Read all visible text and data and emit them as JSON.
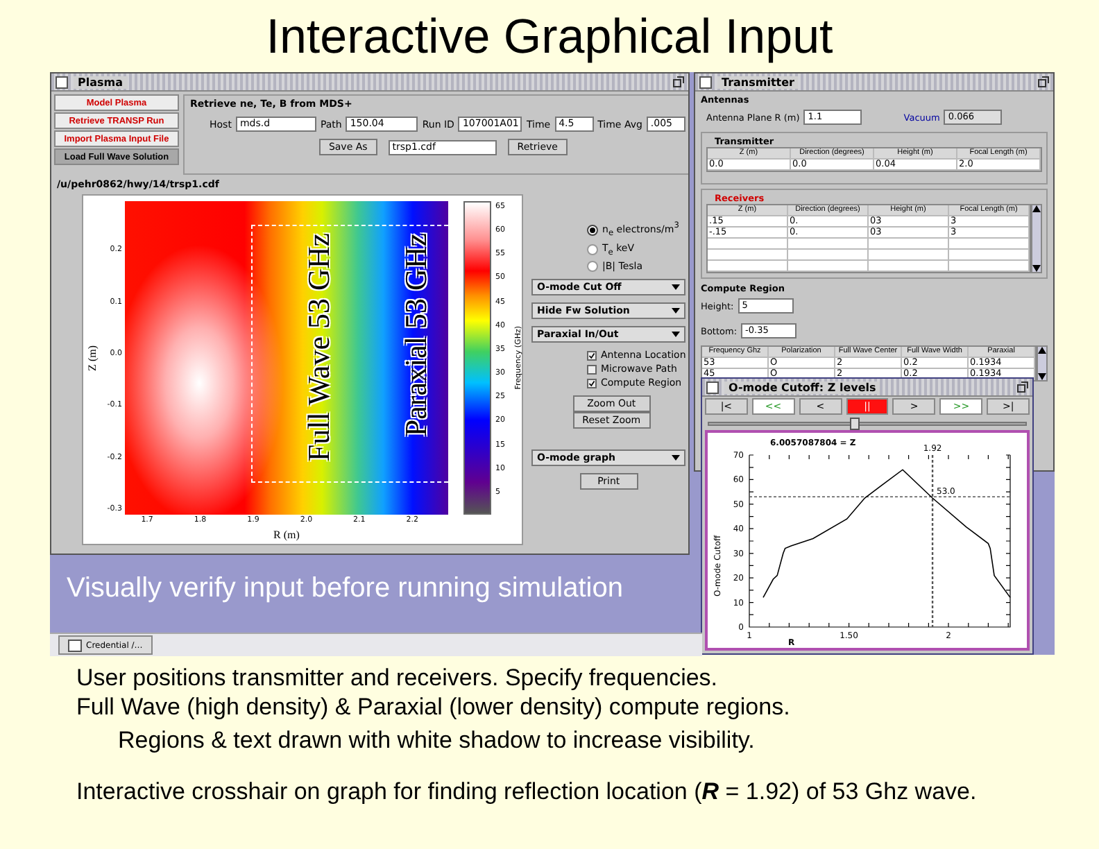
{
  "title": "Interactive Graphical Input",
  "plasma_window": {
    "title": "Plasma",
    "modes": [
      {
        "label": "Model Plasma",
        "selected": false
      },
      {
        "label": "Retrieve TRANSP Run",
        "selected": false
      },
      {
        "label": "Import Plasma Input File",
        "selected": false
      },
      {
        "label": "Load Full Wave Solution",
        "selected": true
      }
    ],
    "mds_label": "Retrieve ne, Te, B from MDS+",
    "fields": [
      {
        "label": "Host",
        "value": "mds.d"
      },
      {
        "label": "Path",
        "value": "150.04"
      },
      {
        "label": "Run ID",
        "value": "107001A01"
      },
      {
        "label": "Time",
        "value": "4.5"
      },
      {
        "label": "Time Avg",
        "value": ".005"
      }
    ],
    "save_button": "Save As",
    "save_field": "trsp1.cdf",
    "retrieve_button": "Retrieve",
    "file_path": "/u/pehr0862/hwy/14/trsp1.cdf",
    "contour_plot": {
      "xlabel": "R (m)",
      "ylabel": "Z (m)",
      "xticks": [
        "1.7",
        "1.8",
        "1.9",
        "2.0",
        "2.1",
        "2.2"
      ],
      "yticks": [
        "0.2",
        "0.1",
        "0.0",
        "-0.1",
        "-0.2",
        "-0.3"
      ],
      "colorbar_label": "Frequency (GHz)",
      "colorbar_ticks": [
        "65",
        "60",
        "55",
        "50",
        "45",
        "40",
        "35",
        "30",
        "25",
        "20",
        "15",
        "10",
        "5"
      ],
      "overlays": [
        "Full Wave 53 GHz",
        "Paraxial 53 GHz"
      ]
    },
    "quantities": [
      {
        "label": "n$_{e}$ electrons/m$^{3}$",
        "selected": true
      },
      {
        "label": "T$_{e}$ keV",
        "selected": false
      },
      {
        "label": "|B| Tesla",
        "selected": false
      }
    ],
    "dropdowns": [
      "O-mode Cut Off",
      "Hide Fw Solution",
      "Paraxial In/Out"
    ],
    "checkboxes": [
      {
        "label": "Antenna Location",
        "checked": true
      },
      {
        "label": "Microwave Path",
        "checked": false
      },
      {
        "label": "Compute Region",
        "checked": true
      }
    ],
    "zoom_buttons": [
      "Zoom Out",
      "Reset Zoom"
    ],
    "graph_dropdown": "O-mode graph",
    "print_button": "Print"
  },
  "transmitter_window": {
    "title": "Transmitter",
    "antennas_header": "Antennas",
    "antenna_plane": {
      "label": "Antenna Plane R (m)",
      "value": "1.1"
    },
    "vacuum": {
      "label": "Vacuum",
      "value": "0.066"
    },
    "transmitter": {
      "header": "Transmitter",
      "columns": [
        "Z (m)",
        "Direction (degrees)",
        "Height (m)",
        "Focal Length (m)"
      ],
      "rows": [
        [
          "0.0",
          "0.0",
          "0.04",
          "2.0"
        ]
      ]
    },
    "receivers": {
      "header": "Receivers",
      "columns": [
        "Z (m)",
        "Direction (degrees)",
        "Height (m)",
        "Focal Length (m)"
      ],
      "rows": [
        [
          ".15",
          "0.",
          "03",
          "3"
        ],
        [
          "-.15",
          "0.",
          "03",
          "3"
        ]
      ]
    },
    "compute_header": "Compute Region",
    "height": {
      "label": "Height:",
      "value": "5"
    },
    "bottom": {
      "label": "Bottom:",
      "value": "-0.35"
    },
    "frequencies": {
      "columns": [
        "Frequency Ghz",
        "Polarization",
        "Full Wave Center",
        "Full Wave Width",
        "Paraxial"
      ],
      "rows": [
        [
          "53",
          "O",
          "2",
          "0.2",
          "0.1934"
        ],
        [
          "45",
          "O",
          "2",
          "0.2",
          "0.1934"
        ]
      ]
    }
  },
  "cutoff_window": {
    "title": "O-mode Cutoff: Z levels",
    "controls": [
      {
        "label": "|<",
        "kind": "step",
        "selected": false
      },
      {
        "label": "<<",
        "kind": "fast",
        "selected": false
      },
      {
        "label": "<",
        "kind": "step",
        "selected": false
      },
      {
        "label": "||",
        "kind": "step",
        "selected": true
      },
      {
        "label": ">",
        "kind": "step",
        "selected": false
      },
      {
        "label": ">>",
        "kind": "fast",
        "selected": false
      },
      {
        "label": ">|",
        "kind": "step",
        "selected": false
      }
    ],
    "slider": {
      "level": 0.46
    },
    "chart_data": {
      "type": "line",
      "title": "6.0057087804 = Z",
      "xlabel": "R",
      "ylabel": "O-mode Cutoff",
      "xlim": [
        1,
        2.31
      ],
      "ylim": [
        0,
        70
      ],
      "x": [
        1.07,
        1.12,
        1.14,
        1.17,
        1.18,
        1.21,
        1.32,
        1.49,
        1.58,
        1.77,
        1.92,
        2.09,
        2.2,
        2.21,
        2.23,
        2.31
      ],
      "series": [
        {
          "color": "#000000",
          "values": [
            12,
            19.5,
            21,
            30,
            32,
            33,
            36,
            44,
            52.5,
            64,
            52.5,
            40.7,
            34,
            32,
            21,
            12
          ]
        }
      ],
      "xticks": [
        {
          "value": 1,
          "label": "1"
        },
        {
          "value": 1.5,
          "label": "1.50"
        },
        {
          "value": 2,
          "label": "2"
        }
      ],
      "yticks": [
        0,
        10,
        20,
        30,
        40,
        50,
        60,
        70
      ],
      "ref_lines": [
        {
          "axis": "x",
          "value": 1.92,
          "label": "1.92"
        },
        {
          "axis": "y",
          "value": 53,
          "label": "53.0"
        }
      ]
    }
  },
  "caption": "Visually verify input before running simulation",
  "taskbar": [
    {
      "label": "Credential /…"
    }
  ],
  "notes": [
    {
      "text": "User positions transmitter and receivers.  Specify frequencies."
    },
    {
      "text": "Full Wave (high density) & Paraxial (lower density) compute regions.",
      "children": [
        {
          "text": "Regions & text drawn with white shadow to increase visibility."
        }
      ]
    },
    {
      "text": "Interactive crosshair on graph for finding reflection location (**R** = 1.92) of 53 Ghz wave."
    }
  ]
}
